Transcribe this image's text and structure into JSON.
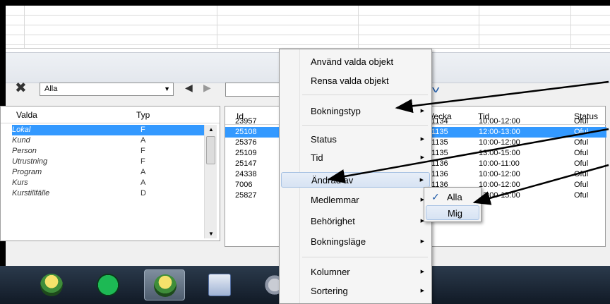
{
  "filter": {
    "combo_value": "Alla"
  },
  "left_table": {
    "headers": {
      "valda": "Valda",
      "typ": "Typ"
    },
    "rows": [
      {
        "name": "Lokal",
        "type": "F"
      },
      {
        "name": "Kund",
        "type": "A"
      },
      {
        "name": "Person",
        "type": "F"
      },
      {
        "name": "Utrustning",
        "type": "F"
      },
      {
        "name": "Program",
        "type": "A"
      },
      {
        "name": "Kurs",
        "type": "A"
      },
      {
        "name": "Kurstillfälle",
        "type": "D"
      }
    ]
  },
  "right_table": {
    "headers": {
      "id": "Id",
      "vecka": "Vecka",
      "tid": "Tid",
      "status": "Status"
    },
    "rows": [
      {
        "id": "23957",
        "vecka": "1134",
        "tid": "10:00-12:00",
        "status": "Oful"
      },
      {
        "id": "25108",
        "vecka": "1135",
        "tid": "12:00-13:00",
        "status": "Oful"
      },
      {
        "id": "25376",
        "vecka": "1135",
        "tid": "10:00-12:00",
        "status": "Oful"
      },
      {
        "id": "25109",
        "vecka": "1135",
        "tid": "13:00-15:00",
        "status": "Oful"
      },
      {
        "id": "25147",
        "vecka": "1136",
        "tid": "10:00-11:00",
        "status": "Oful"
      },
      {
        "id": "24338",
        "vecka": "1136",
        "tid": "10:00-12:00",
        "status": "Oful"
      },
      {
        "id": "7006",
        "vecka": "1136",
        "tid": "10:00-12:00",
        "status": "Oful"
      },
      {
        "id": "25827",
        "vecka": "1136",
        "tid": "13:00-15:00",
        "status": "Oful"
      }
    ]
  },
  "context_menu": {
    "items": [
      "Använd valda objekt",
      "Rensa valda objekt",
      "Bokningstyp",
      "Status",
      "Tid",
      "Ändrad av",
      "Medlemmar",
      "Behörighet",
      "Bokningsläge",
      "Kolumner",
      "Sortering"
    ]
  },
  "submenu": {
    "items": [
      "Alla",
      "Mig"
    ]
  },
  "colors": {
    "selection": "#3399ff",
    "menu_hover": "#d7e3f3",
    "taskbar": "#1a2535"
  }
}
